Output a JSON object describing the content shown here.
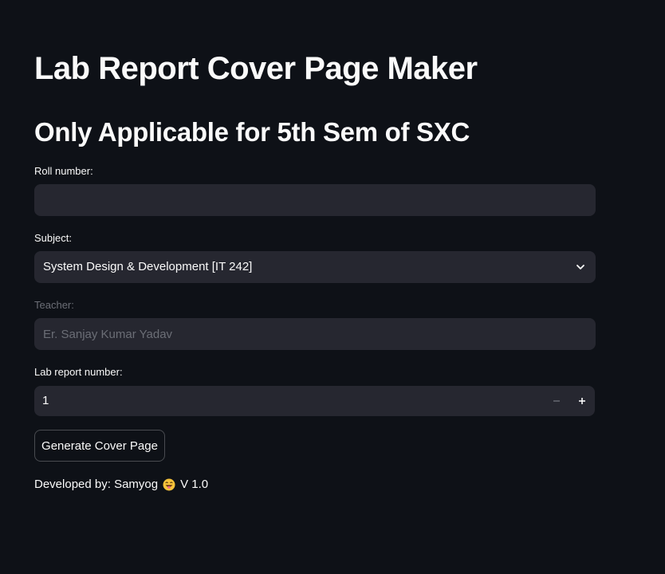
{
  "page": {
    "title": "Lab Report Cover Page Maker",
    "subtitle": "Only Applicable for 5th Sem of SXC"
  },
  "form": {
    "roll_number": {
      "label": "Roll number:",
      "value": ""
    },
    "subject": {
      "label": "Subject:",
      "selected": "System Design & Development [IT 242]"
    },
    "teacher": {
      "label": "Teacher:",
      "placeholder": "Er. Sanjay Kumar Yadav",
      "disabled": true
    },
    "lab_report_number": {
      "label": "Lab report number:",
      "value": "1",
      "minus": "−",
      "plus": "+"
    },
    "generate_button": "Generate Cover Page"
  },
  "footer": {
    "prefix": "Developed by: Samyog",
    "emoji_icon": "grinning-tongue-face-icon",
    "version": "V 1.0"
  },
  "colors": {
    "background": "#0e1117",
    "input_background": "#262730",
    "text": "#fafafa",
    "disabled_text": "#6b6e76"
  }
}
